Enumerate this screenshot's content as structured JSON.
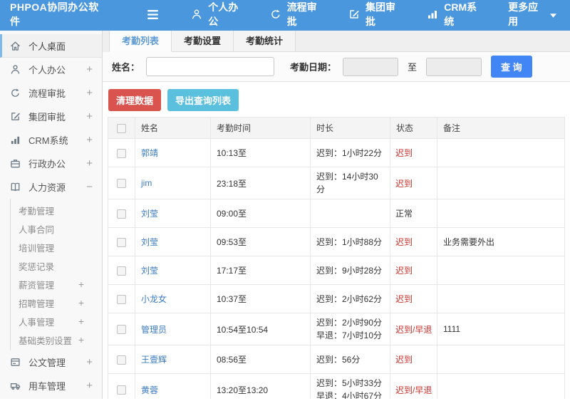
{
  "colors": {
    "topbar": "#4a97dd",
    "accent": "#4285f4",
    "danger": "#d9534f",
    "info": "#5bc0de",
    "link": "#3a7abf",
    "statusRed": "#c9302c",
    "activeTabText": "#5e9ad3",
    "sidebarActiveBorder": "#7db9ea"
  },
  "topbar": {
    "title": "PHPOA协同办公软件",
    "nav": [
      {
        "key": "personal-office",
        "label": "个人办公",
        "icon": "user"
      },
      {
        "key": "workflow-approval",
        "label": "流程审批",
        "icon": "flow"
      },
      {
        "key": "group-approval",
        "label": "集团审批",
        "icon": "edit"
      },
      {
        "key": "crm",
        "label": "CRM系统",
        "icon": "chart"
      },
      {
        "key": "more-apps",
        "label": "更多应用",
        "icon": null,
        "caret": true
      }
    ]
  },
  "sidebar": {
    "items": [
      {
        "key": "desktop",
        "label": "个人桌面",
        "icon": "home",
        "active": true
      },
      {
        "key": "personal-office",
        "label": "个人办公",
        "icon": "user",
        "expand": "+"
      },
      {
        "key": "workflow-approval",
        "label": "流程审批",
        "icon": "flow",
        "expand": "+"
      },
      {
        "key": "group-approval",
        "label": "集团审批",
        "icon": "edit",
        "expand": "+"
      },
      {
        "key": "crm",
        "label": "CRM系统",
        "icon": "chart",
        "expand": "+"
      },
      {
        "key": "admin-office",
        "label": "行政办公",
        "icon": "briefcase",
        "expand": "+"
      },
      {
        "key": "hr",
        "label": "人力资源",
        "icon": "book",
        "expand": "−",
        "children": [
          {
            "key": "attendance-mgmt",
            "label": "考勤管理"
          },
          {
            "key": "hr-contract",
            "label": "人事合同"
          },
          {
            "key": "training-mgmt",
            "label": "培训管理"
          },
          {
            "key": "reward-punish",
            "label": "奖惩记录"
          },
          {
            "key": "salary-mgmt",
            "label": "薪资管理",
            "expand": "+"
          },
          {
            "key": "recruit-mgmt",
            "label": "招聘管理",
            "expand": "+"
          },
          {
            "key": "personnel-mgmt",
            "label": "人事管理",
            "expand": "+"
          },
          {
            "key": "base-category-settings",
            "label": "基础类别设置",
            "expand": "+"
          }
        ]
      },
      {
        "key": "doc-mgmt",
        "label": "公文管理",
        "icon": "doc",
        "expand": "+"
      },
      {
        "key": "vehicle-mgmt",
        "label": "用车管理",
        "icon": "car",
        "expand": "+"
      }
    ]
  },
  "tabs": {
    "active": 0,
    "items": [
      {
        "key": "attendance-list",
        "label": "考勤列表"
      },
      {
        "key": "attendance-settings",
        "label": "考勤设置"
      },
      {
        "key": "attendance-stats",
        "label": "考勤统计"
      }
    ]
  },
  "filter": {
    "name_label": "姓名：",
    "date_label": "考勤日期：",
    "to_label": "至",
    "search_label": "查 询"
  },
  "actions": {
    "clean_label": "清理数据",
    "export_label": "导出查询列表"
  },
  "table": {
    "headers": [
      "姓名",
      "考勤时间",
      "时长",
      "状态",
      "备注"
    ],
    "rows": [
      {
        "name": "郭靖",
        "time": "10:13至",
        "duration": [
          "迟到：1小时22分"
        ],
        "status": "迟到",
        "status_red": true,
        "note": ""
      },
      {
        "name": "jim",
        "time": "23:18至",
        "duration": [
          "迟到：14小时30",
          "分"
        ],
        "status": "迟到",
        "status_red": true,
        "note": ""
      },
      {
        "name": "刘莹",
        "time": "09:00至",
        "duration": [],
        "status": "正常",
        "status_red": false,
        "note": ""
      },
      {
        "name": "刘莹",
        "time": "09:53至",
        "duration": [
          "迟到：1小时88分"
        ],
        "status": "迟到",
        "status_red": true,
        "note": "业务需要外出"
      },
      {
        "name": "刘莹",
        "time": "17:17至",
        "duration": [
          "迟到：9小时28分"
        ],
        "status": "迟到",
        "status_red": true,
        "note": ""
      },
      {
        "name": "小龙女",
        "time": "10:37至",
        "duration": [
          "迟到：2小时62分"
        ],
        "status": "迟到",
        "status_red": true,
        "note": ""
      },
      {
        "name": "管理员",
        "time": "10:54至10:54",
        "duration": [
          "迟到：2小时90分",
          "早退：7小时10分"
        ],
        "status": "迟到/早退",
        "status_red": true,
        "note": "1111"
      },
      {
        "name": "王壹辉",
        "time": "08:56至",
        "duration": [
          "迟到：56分"
        ],
        "status": "迟到",
        "status_red": true,
        "note": ""
      },
      {
        "name": "黄蓉",
        "time": "13:20至13:20",
        "duration": [
          "迟到：5小时33分",
          "早退：4小时67分"
        ],
        "status": "迟到/早退",
        "status_red": true,
        "note": ""
      }
    ]
  }
}
